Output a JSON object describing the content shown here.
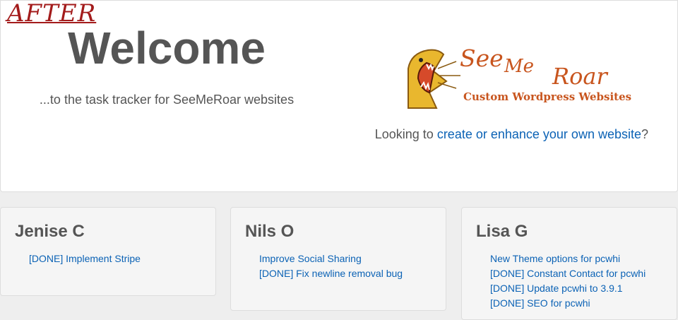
{
  "annotation": {
    "label": "AFTER"
  },
  "hero": {
    "title": "Welcome",
    "subtitle": "...to the task tracker for SeeMeRoar websites",
    "logo": {
      "word1": "See",
      "word2": "Me",
      "word3": "Roar",
      "tagline": "Custom Wordpress Websites"
    },
    "cta": {
      "prefix": "Looking to ",
      "link": "create or enhance your own website",
      "suffix": "?"
    }
  },
  "colors": {
    "heading": "#555555",
    "link": "#0b62b5",
    "brand": "#c8551e",
    "annotation": "#a31b1b"
  },
  "people": [
    {
      "name": "Jenise C",
      "tasks": [
        "[DONE] Implement Stripe"
      ]
    },
    {
      "name": "Nils O",
      "tasks": [
        "Improve Social Sharing",
        "[DONE] Fix newline removal bug"
      ]
    },
    {
      "name": "Lisa G",
      "tasks": [
        "New Theme options for pcwhi",
        "[DONE] Constant Contact for pcwhi",
        "[DONE] Update pcwhi to 3.9.1",
        "[DONE] SEO for pcwhi"
      ]
    }
  ]
}
